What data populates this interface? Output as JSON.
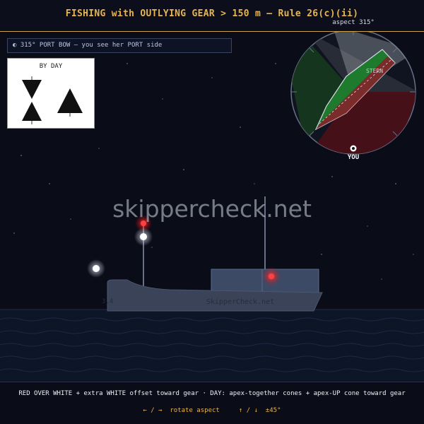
{
  "header": {
    "title": "FISHING with OUTLYING GEAR > 150 m — Rule 26(c)(ii)",
    "aspect_label": "aspect 315°"
  },
  "aspect_bar": {
    "text": "◐ 315°  PORT BOW — you see her PORT side"
  },
  "day_shapes": {
    "title": "BY DAY"
  },
  "radar": {
    "stern_label": "STERN",
    "you_label": "YOU"
  },
  "vessel": {
    "hull_name": "SkipperCheck.net"
  },
  "watermark": "skippercheck.net",
  "footer": {
    "description": "RED OVER WHITE + extra WHITE offset toward gear · DAY: apex-together cones + apex-UP cone toward gear",
    "controls": "← / →  rotate aspect     ↑ / ↓  ±45°"
  },
  "colors": {
    "accent_gold": "#e6b450",
    "light_red": "#ff3030",
    "light_white": "#ffffff",
    "port_green": "#2e8b3a",
    "starboard_red": "#a3202c",
    "sky": "#0a0c18",
    "sea": "#0c1626"
  }
}
